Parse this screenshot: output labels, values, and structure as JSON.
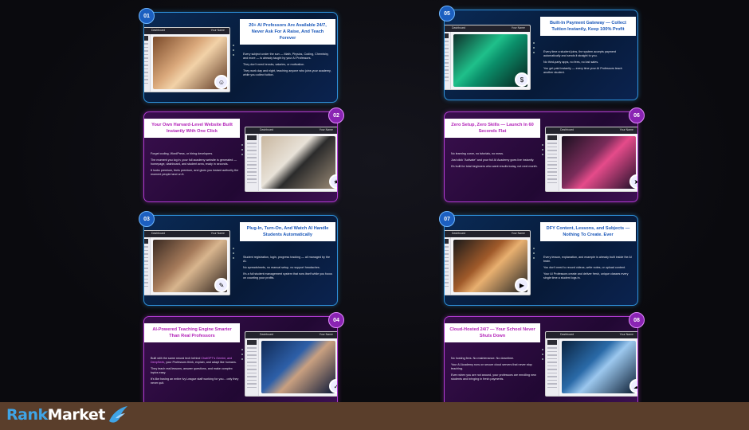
{
  "colors": {
    "blue_border": "#2e8fd8",
    "purple_border": "#b03ad0",
    "footer": "#5a3e2b",
    "logo_rank": "#3fa4e6"
  },
  "brand": {
    "part1": "Rank",
    "part2": "Market"
  },
  "cards": [
    {
      "num": "01",
      "title": "20+ AI Professors Are Available 24/7, Never Ask For A Raise, And Teach Forever",
      "paras": [
        "Every subject under the sun — Math, Physics, Coding, Chemistry, and more — is already taught by your AI Professors.",
        "They don't need breaks, salaries, or motivation.",
        "They work day and night, teaching anyone who joins your academy, while you collect tuition."
      ],
      "app": "Dashboard",
      "user": "Your Name"
    },
    {
      "num": "02",
      "title": "Your Own Harvard-Level Website Built Instantly With One Click",
      "paras": [
        "Forget coding, WordPress, or hiring developers.",
        "The moment you log in, your full academy website is generated — homepage, dashboard, and student area, ready in seconds.",
        "It looks premium, feels premium, and gives you instant authority the moment people land on it."
      ],
      "app": "Dashboard",
      "user": "Your Name"
    },
    {
      "num": "03",
      "title": "Plug-In, Turn-On, And Watch AI Handle Students Automatically",
      "paras": [
        "Student registration, login, progress tracking — all managed by the AI.",
        "No spreadsheets, no manual setup, no support headaches.",
        "It's a full student management system that runs itself while you focus on counting your profits."
      ],
      "app": "Dashboard",
      "user": "Your Name"
    },
    {
      "num": "04",
      "title": "AI-Powered Teaching Engine Smarter Than Real Professors",
      "paras_pre": "Built with the same neural tech behind ",
      "paras_hl": "ChatGPT's Gemini, and DeepSeek",
      "paras_post": ", your Professors think, explain, and adapt like humans.",
      "paras": [
        "They teach real lessons, answer questions, and make complex topics easy.",
        "It's like having an entire Ivy League staff working for you... only they never quit."
      ],
      "app": "Dashboard",
      "user": "Your Name"
    },
    {
      "num": "05",
      "title": "Built-In Payment Gateway — Collect Tuition Instantly, Keep 100% Profit",
      "paras": [
        "Every time a student joins, the system accepts payment automatically and sends it straight to you.",
        "No third-party apps, no fees, no lost sales.",
        "You get paid instantly — every time your AI Professors teach another student."
      ],
      "app": "Dashboard",
      "user": "Your Name"
    },
    {
      "num": "06",
      "title": "Zero Setup, Zero Skills — Launch In 60 Seconds Flat",
      "paras": [
        "No learning curve, no tutorials, no mess.",
        "Just click \"Activate\" and your full AI Academy goes live instantly.",
        "It's built for total beginners who want results today, not next month."
      ],
      "app": "Dashboard",
      "user": "Your Name"
    },
    {
      "num": "07",
      "title": "DFY Content, Lessons, and Subjects — Nothing To Create. Ever",
      "paras": [
        "Every lesson, explanation, and example is already built inside the AI brain.",
        "You don't need to record videos, write notes, or upload content.",
        "Your AI Professors create and deliver fresh, unique classes every single time a student logs in."
      ],
      "app": "Dashboard",
      "user": "Your Name"
    },
    {
      "num": "08",
      "title": "Cloud-Hosted 24/7 — Your School Never Shuts Down",
      "paras": [
        "No hosting fees. No maintenance. No downtime.",
        "Your AI Academy runs on secure cloud servers that never stop teaching.",
        "Even when you are not around, your professors are enrolling new students and bringing in fresh payments."
      ],
      "app": "Dashboard",
      "user": "Your Name"
    }
  ],
  "icons": [
    "teacher-avatar-icon",
    "website-icon",
    "student-icon",
    "graduation-icon",
    "money-icon",
    "rocket-icon",
    "video-icon",
    "cloud-icon",
    "bird-logo-icon"
  ]
}
